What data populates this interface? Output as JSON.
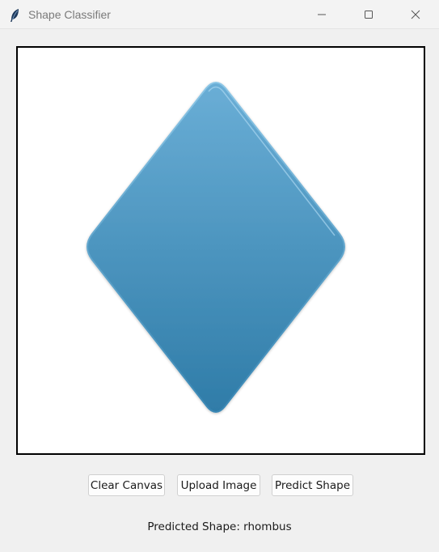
{
  "window": {
    "title": "Shape Classifier",
    "controls": {
      "minimize_icon": "minimize-icon",
      "maximize_icon": "maximize-icon",
      "close_icon": "close-icon"
    }
  },
  "canvas": {
    "shape_icon": "rhombus-shape",
    "shape_color_top": "#6aaed6",
    "shape_color_bottom": "#2f7ca8"
  },
  "buttons": {
    "clear_label": "Clear Canvas",
    "upload_label": "Upload Image",
    "predict_label": "Predict Shape"
  },
  "result": {
    "text": "Predicted Shape: rhombus"
  }
}
